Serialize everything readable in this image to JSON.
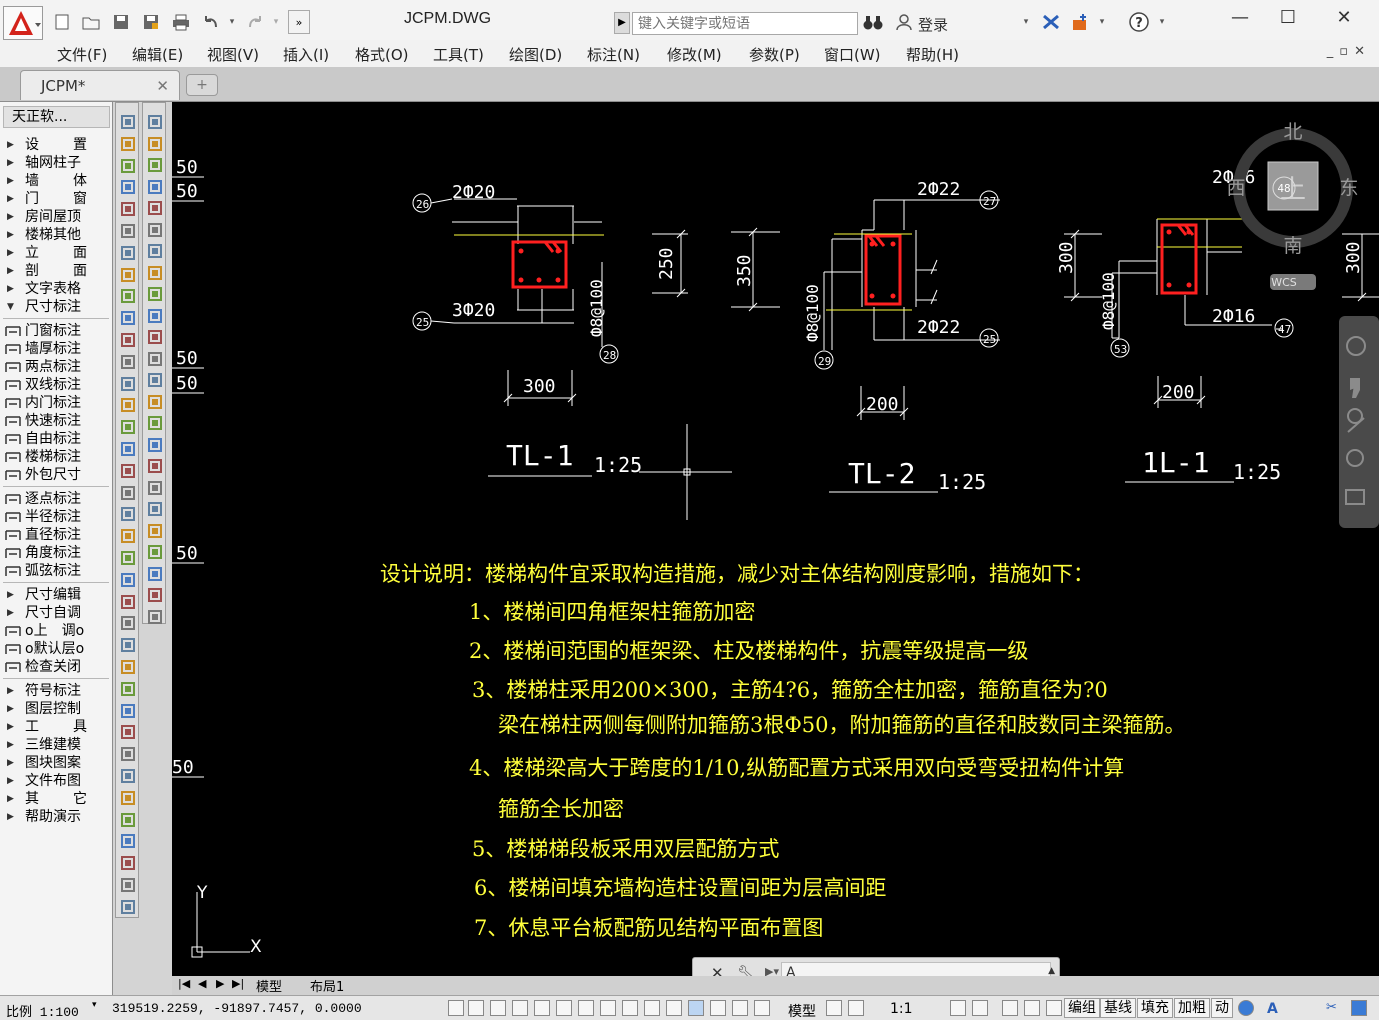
{
  "window": {
    "title": "JCPM.DWG",
    "search_placeholder": "键入关键字或短语",
    "login_label": "登录"
  },
  "menu": [
    "文件(F)",
    "编辑(E)",
    "视图(V)",
    "插入(I)",
    "格式(O)",
    "工具(T)",
    "绘图(D)",
    "标注(N)",
    "修改(M)",
    "参数(P)",
    "窗口(W)",
    "帮助(H)"
  ],
  "tabs": {
    "document": "JCPM*"
  },
  "panel": {
    "title": "天正软...",
    "sections": [
      [
        {
          "label": "设置",
          "spread": true
        },
        {
          "label": "轴网柱子"
        },
        {
          "label": "墙体",
          "spread": true
        },
        {
          "label": "门窗",
          "spread": true
        },
        {
          "label": "房间屋顶"
        },
        {
          "label": "楼梯其他"
        },
        {
          "label": "立面",
          "spread": true
        },
        {
          "label": "剖面",
          "spread": true
        },
        {
          "label": "文字表格"
        },
        {
          "label": "尺寸标注",
          "expanded": true
        }
      ],
      [
        {
          "label": "门窗标注",
          "icon": true
        },
        {
          "label": "墙厚标注",
          "icon": true
        },
        {
          "label": "两点标注",
          "icon": true
        },
        {
          "label": "双线标注",
          "icon": true
        },
        {
          "label": "内门标注",
          "icon": true
        },
        {
          "label": "快速标注",
          "icon": true
        },
        {
          "label": "自由标注",
          "icon": true
        },
        {
          "label": "楼梯标注",
          "icon": true
        },
        {
          "label": "外包尺寸",
          "icon": true
        }
      ],
      [
        {
          "label": "逐点标注",
          "icon": true
        },
        {
          "label": "半径标注",
          "icon": true
        },
        {
          "label": "直径标注",
          "icon": true
        },
        {
          "label": "角度标注",
          "icon": true
        },
        {
          "label": "弧弦标注",
          "icon": true
        }
      ],
      [
        {
          "label": "尺寸编辑"
        },
        {
          "label": "尺寸自调"
        },
        {
          "label": "o上　调o",
          "icon": true
        },
        {
          "label": "o默认层o",
          "icon": true
        },
        {
          "label": "检查关闭",
          "icon": true
        }
      ],
      [
        {
          "label": "符号标注"
        },
        {
          "label": "图层控制"
        },
        {
          "label": "工具",
          "spread": true
        },
        {
          "label": "三维建模"
        },
        {
          "label": "图块图案"
        },
        {
          "label": "文件布图"
        },
        {
          "label": "其它",
          "spread": true
        },
        {
          "label": "帮助演示"
        }
      ]
    ]
  },
  "drawing": {
    "left_edge_dims": [
      "50",
      "50",
      "50",
      "50",
      "50",
      "50"
    ],
    "viewcube": {
      "north": "北",
      "south": "南",
      "east": "东",
      "west": "西",
      "top": "上",
      "wcs": "WCS"
    },
    "sections": [
      {
        "name": "TL-1",
        "scale": "1:25",
        "top_rebar": "2Ф20",
        "bottom_rebar": "3Ф20",
        "stirrup": "Ф8@100",
        "height": "250",
        "width": "300",
        "tags": [
          "26",
          "25",
          "28"
        ]
      },
      {
        "name": "TL-2",
        "scale": "1:25",
        "top_rebar": "2Ф22",
        "bottom_rebar": "2Ф22",
        "stirrup": "Ф8@100",
        "height": "350",
        "width": "200",
        "tags": [
          "27",
          "25",
          "29"
        ]
      },
      {
        "name": "1L-1",
        "scale": "1:25",
        "top_rebar": "2Ф16",
        "bottom_rebar": "2Ф16",
        "stirrup": "Ф8@100",
        "height": "300",
        "height_right": "300",
        "width": "200",
        "tags": [
          "48",
          "47",
          "53"
        ]
      }
    ],
    "notes": {
      "heading": "设计说明：楼梯构件宜采取构造措施，减少对主体结构刚度影响，措施如下：",
      "items": [
        "1、楼梯间四角框架柱箍筋加密",
        "2、楼梯间范围的框架梁、柱及楼梯构件，抗震等级提高一级",
        "3、楼梯柱采用200×300，主筋4?6，箍筋全柱加密，箍筋直径为?0",
        "梁在梯柱两侧每侧附加箍筋3根Ф50，附加箍筋的直径和肢数同主梁箍筋。",
        "4、楼梯梁高大于跨度的1/10,纵筋配置方式采用双向受弯受扭构件计算",
        "箍筋全长加密",
        "5、楼梯梯段板采用双层配筋方式",
        "6、楼梯间填充墙构造柱设置间距为层高间距",
        "7、休息平台板配筋见结构平面布置图"
      ]
    },
    "ucs": {
      "x": "X",
      "y": "Y"
    }
  },
  "layout_tabs": [
    "模型",
    "布局1"
  ],
  "command": {
    "value": "A"
  },
  "status": {
    "scale": "比例 1:100",
    "coords": "319519.2259,  -91897.7457,  0.0000",
    "model_label": "模型",
    "annot_scale": "1:1",
    "buttons": [
      "编组",
      "基线",
      "填充",
      "加粗",
      "动"
    ]
  },
  "colors": {
    "canvas": "#000000",
    "drawing_lines": "#ffffff",
    "beam_rebar": "#ff2020",
    "yellow_text": "#ffff3c",
    "dim_green": "#ffffff"
  }
}
